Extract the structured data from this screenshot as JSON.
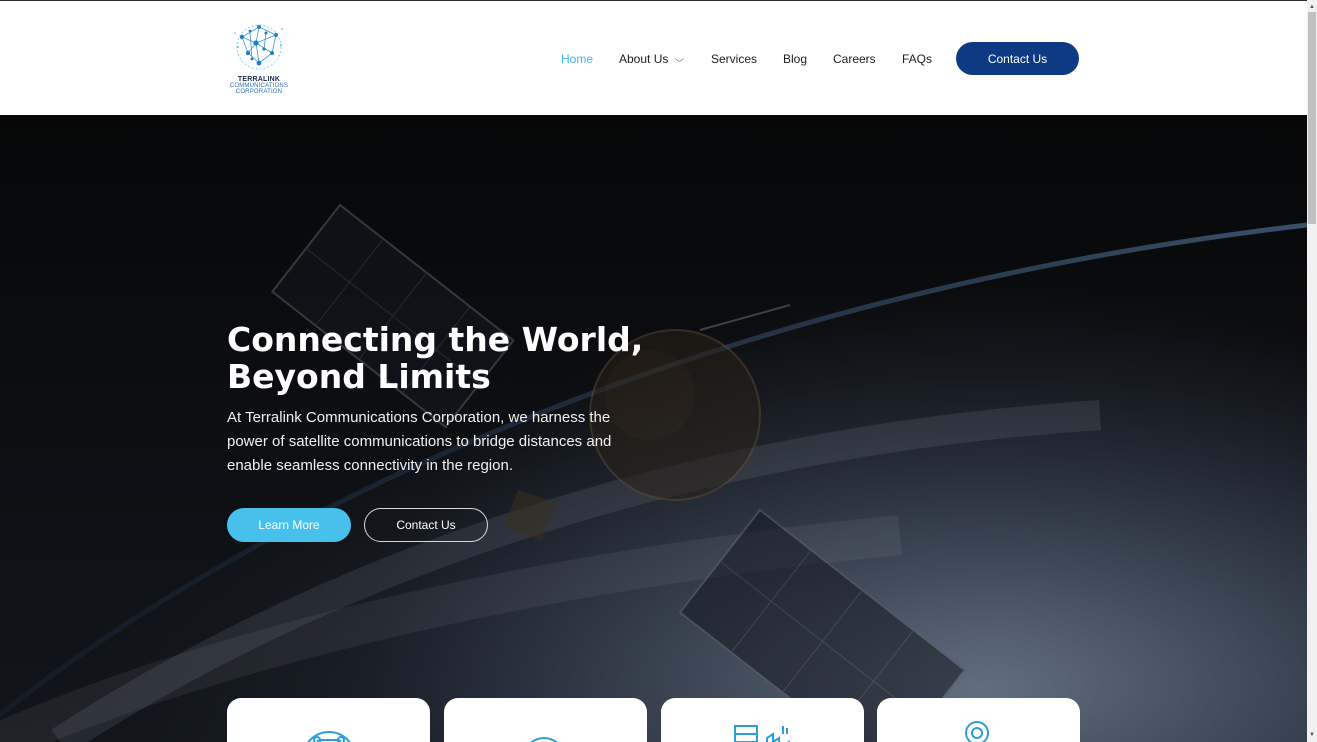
{
  "logo": {
    "line1": "TERRALINK",
    "line2": "COMMUNICATIONS",
    "line3": "CORPORATION",
    "icon": "globe-network-icon"
  },
  "nav": {
    "items": [
      {
        "label": "Home",
        "active": true
      },
      {
        "label": "About Us",
        "has_dropdown": true
      },
      {
        "label": "Services"
      },
      {
        "label": "Blog"
      },
      {
        "label": "Careers"
      },
      {
        "label": "FAQs"
      }
    ],
    "cta_label": "Contact Us"
  },
  "hero": {
    "title_line1": "Connecting the World,",
    "title_line2": "Beyond Limits",
    "subtitle": "At Terralink Communications Corporation, we harness the power of satellite communications to bridge distances and enable seamless connectivity in the region.",
    "primary_button": "Learn More",
    "secondary_button": "Contact Us"
  },
  "feature_cards": [
    {
      "icon": "network-globe-icon"
    },
    {
      "icon": "satellite-dish-icon"
    },
    {
      "icon": "city-buildings-icon"
    },
    {
      "icon": "user-location-icon"
    }
  ],
  "colors": {
    "accent": "#3fb8e6",
    "primary_button": "#47c1ec",
    "brand_navy": "#0d3a82",
    "hero_bg": "#0b0d10"
  }
}
